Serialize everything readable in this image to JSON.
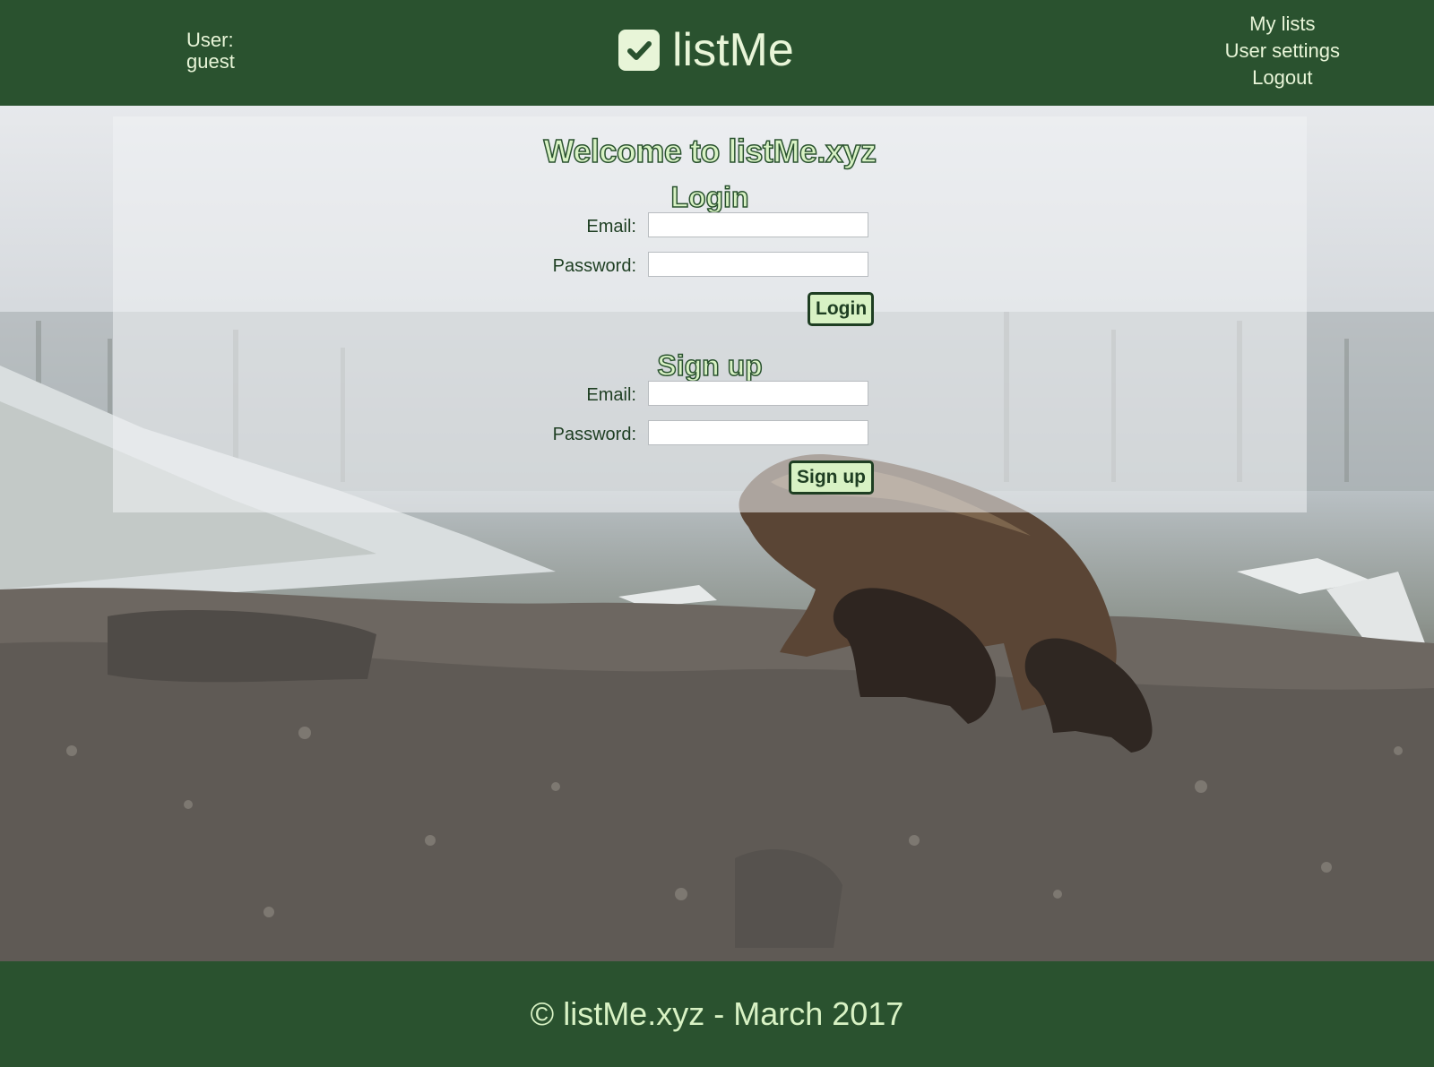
{
  "header": {
    "user_label": "User:",
    "user_name": "guest",
    "logo_text": "listMe",
    "nav": {
      "my_lists": "My lists",
      "user_settings": "User settings",
      "logout": "Logout"
    }
  },
  "main": {
    "welcome": "Welcome to listMe.xyz",
    "login": {
      "title": "Login",
      "email_label": "Email:",
      "email_value": "",
      "password_label": "Password:",
      "password_value": "",
      "button": "Login"
    },
    "signup": {
      "title": "Sign up",
      "email_label": "Email:",
      "email_value": "",
      "password_label": "Password:",
      "password_value": "",
      "button": "Sign up"
    }
  },
  "footer": {
    "text": "© listMe.xyz - March 2017"
  },
  "colors": {
    "header_bg": "#2a522f",
    "accent_light": "#d8f2c4",
    "text_dark": "#1e3e22"
  },
  "icons": {
    "logo": "checkbox-checked-icon"
  }
}
